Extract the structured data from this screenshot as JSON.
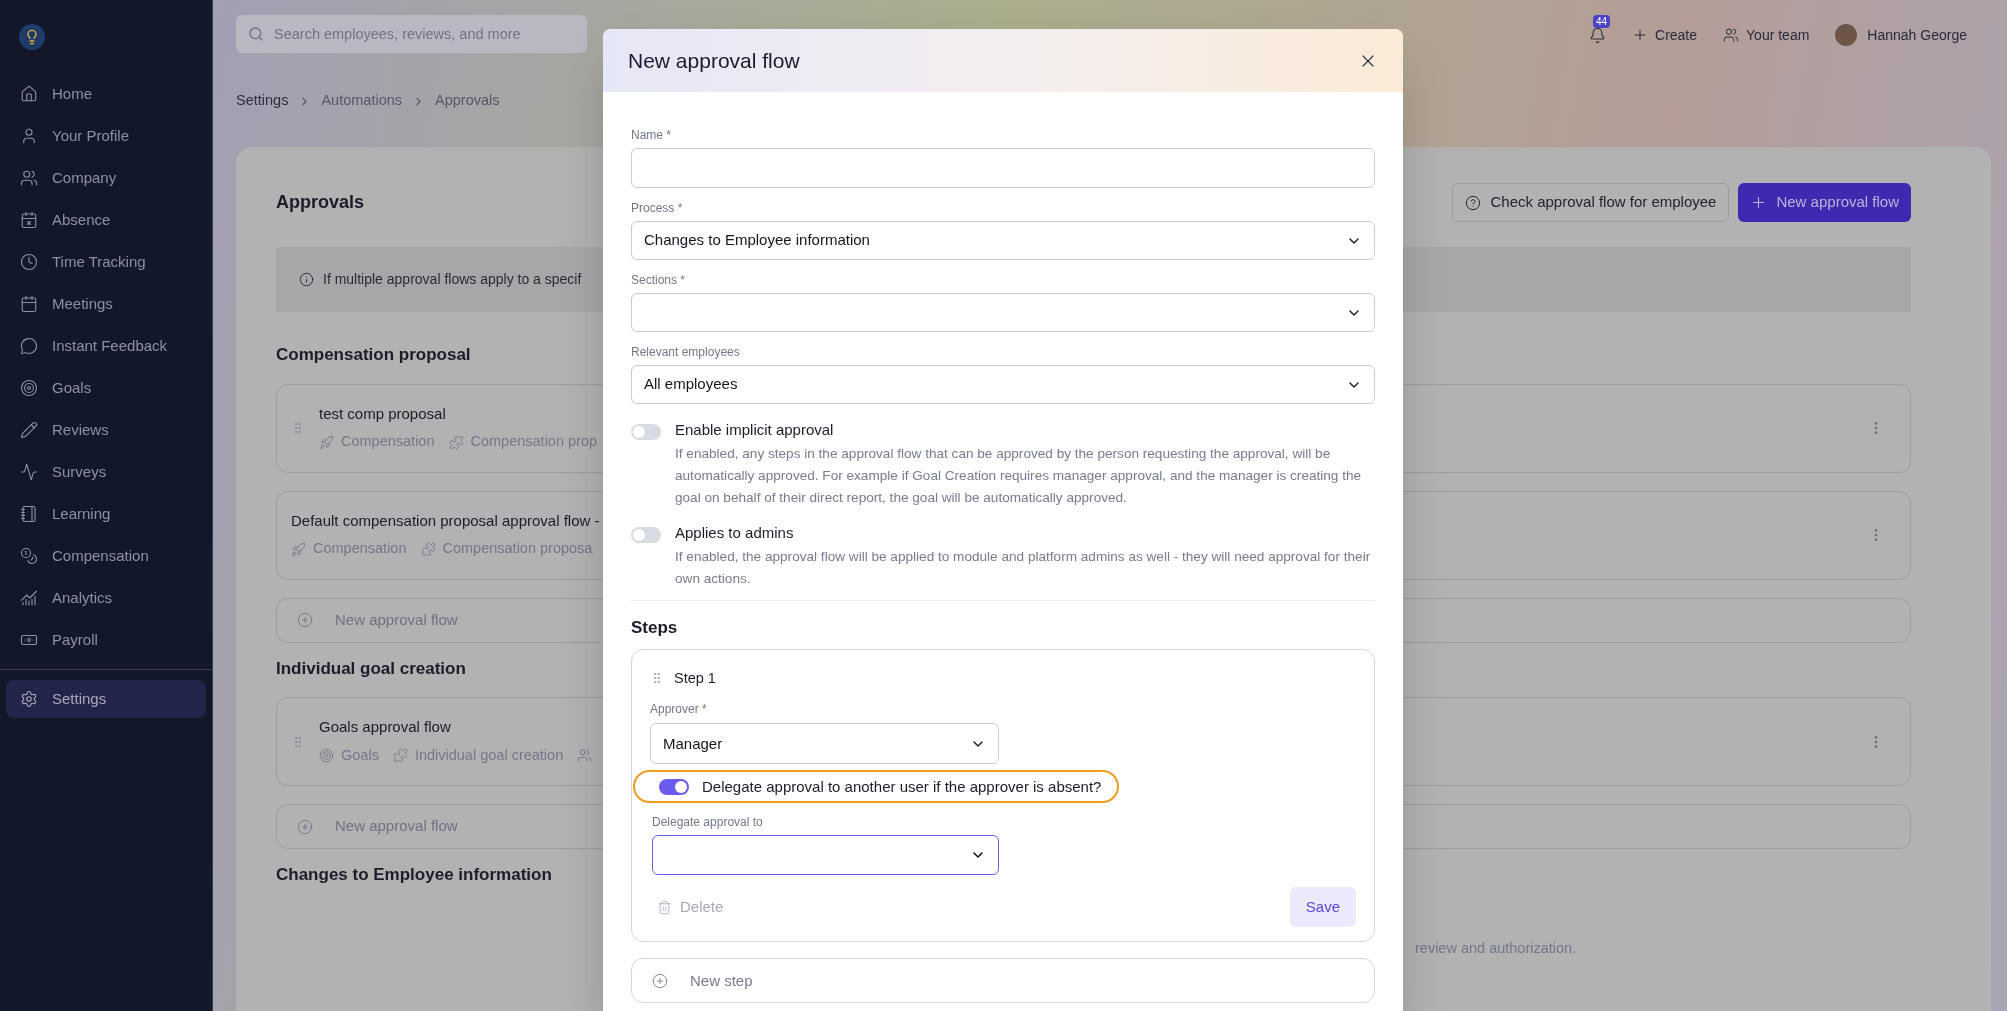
{
  "sidebar": {
    "items": [
      {
        "label": "Home",
        "selected": false
      },
      {
        "label": "Your Profile",
        "selected": false
      },
      {
        "label": "Company",
        "selected": false
      },
      {
        "label": "Absence",
        "selected": false
      },
      {
        "label": "Time Tracking",
        "selected": false
      },
      {
        "label": "Meetings",
        "selected": false
      },
      {
        "label": "Instant Feedback",
        "selected": false
      },
      {
        "label": "Goals",
        "selected": false
      },
      {
        "label": "Reviews",
        "selected": false
      },
      {
        "label": "Surveys",
        "selected": false
      },
      {
        "label": "Learning",
        "selected": false
      },
      {
        "label": "Compensation",
        "selected": false
      },
      {
        "label": "Analytics",
        "selected": false
      },
      {
        "label": "Payroll",
        "selected": false
      }
    ],
    "bottom_items": [
      {
        "label": "Settings",
        "selected": true
      }
    ]
  },
  "header": {
    "search": {
      "placeholder": "Search employees, reviews, and more"
    },
    "notifications": "44",
    "actions": [
      "Create",
      "Your team"
    ],
    "user": "Hannah George"
  },
  "breadcrumb": [
    "Settings",
    "Automations",
    "Approvals"
  ],
  "page": {
    "title": "Approvals",
    "buttons": [
      {
        "label": "Check approval flow for employee",
        "kind": "secondary"
      },
      {
        "label": "New approval flow",
        "kind": "primary"
      }
    ],
    "info": "If multiple approval flows apply to a specif",
    "sections": [
      {
        "title": "Compensation proposal",
        "flows": [
          {
            "name": "test comp proposal",
            "draggable": true,
            "tags": [
              {
                "kind": "compensation_module",
                "label": "Compensation"
              },
              {
                "kind": "process",
                "label": "Compensation prop"
              }
            ]
          },
          {
            "name": "Default compensation proposal approval flow -",
            "draggable": false,
            "tags": [
              {
                "kind": "compensation_module",
                "label": "Compensation"
              },
              {
                "kind": "process",
                "label": "Compensation proposa"
              }
            ]
          }
        ],
        "add_label": "New approval flow"
      },
      {
        "title": "Individual goal creation",
        "flows": [
          {
            "name": "Goals approval flow",
            "draggable": true,
            "tags": [
              {
                "kind": "goals_module",
                "label": "Goals"
              },
              {
                "kind": "process",
                "label": "Individual goal creation"
              },
              {
                "kind": "employees"
              }
            ]
          }
        ],
        "add_label": "New approval flow"
      },
      {
        "title": "Changes to Employee information",
        "description": "review and authorization."
      }
    ]
  },
  "modal": {
    "title": "New approval flow",
    "fields": [
      {
        "label": "Name *",
        "kind": "input"
      },
      {
        "label": "Process *",
        "kind": "select",
        "value": "Changes to Employee information"
      },
      {
        "label": "Sections *",
        "kind": "select"
      },
      {
        "label": "Relevant employees",
        "kind": "select",
        "value": "All employees"
      }
    ],
    "toggles": [
      {
        "label": "Enable implicit approval",
        "on": false,
        "description": "If enabled, any steps in the approval flow that can be approved by the person requesting the approval, will be automatically approved. For example if Goal Creation requires manager approval, and the manager is creating the goal on behalf of their direct report, the goal will be automatically approved."
      },
      {
        "label": "Applies to admins",
        "on": false,
        "description": "If enabled, the approval flow will be applied to module and platform admins as well - they will need approval for their own actions."
      }
    ],
    "steps_title": "Steps",
    "steps": [
      {
        "title": "Step 1",
        "approver_label": "Approver *",
        "approver": "Manager",
        "delegate_toggle": {
          "label": "Delegate approval to another user if the approver is absent?",
          "on": true,
          "highlighted": true
        },
        "delegate_label": "Delegate approval to",
        "delegate_focused": true,
        "delete_label": "Delete",
        "save_label": "Save"
      }
    ],
    "new_step": "New step"
  }
}
